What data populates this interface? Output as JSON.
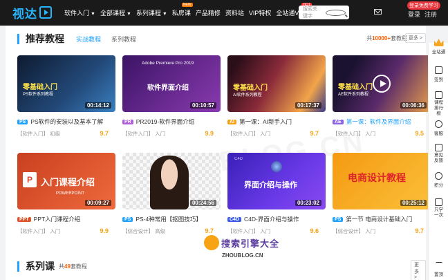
{
  "header": {
    "logo": "视达",
    "nav": [
      {
        "label": "软件入门",
        "caret": true
      },
      {
        "label": "全部课程",
        "caret": true
      },
      {
        "label": "系列课程",
        "caret": true
      },
      {
        "label": "私房课",
        "badge": "NEW"
      },
      {
        "label": "产品精修"
      },
      {
        "label": "资料站"
      },
      {
        "label": "VIP特权"
      },
      {
        "label": "全站通VIP",
        "badge": "HOT"
      }
    ],
    "search_placeholder": "搜索关键字",
    "promo": "登录免费学习",
    "login": "登录",
    "register": "注册"
  },
  "section": {
    "title": "推荐教程",
    "tab_active": "实战教程",
    "tab": "系列教程",
    "total_prefix": "共",
    "total_count": "10000+",
    "total_suffix": "套教程",
    "more": "更多 >"
  },
  "cards": [
    {
      "thumb_title": "零基础入门",
      "thumb_sub": "PS软件系列教程",
      "duration": "00:14:12",
      "tag": "PS",
      "title": "PS软件的安装以及基本了解",
      "category": "【软件入门】",
      "level": "初级",
      "score": "9.7",
      "bg": "#1d2a44",
      "tagColor": "#1fa3ff"
    },
    {
      "thumb_title": "软件界面介绍",
      "thumb_sub": "Adobe Premiere Pro 2019",
      "duration": "00:10:57",
      "tag": "PR",
      "title": "PR2019-软件界面介绍",
      "category": "【软件入门】",
      "level": "入门",
      "score": "9.9",
      "bg": "#5a2a8a",
      "tagColor": "#b05cdc"
    },
    {
      "thumb_title": "零基础入门",
      "thumb_sub": "AI软件系列教程",
      "duration": "00:17:37",
      "tag": "AI",
      "title": "第一课：AI新手入门",
      "category": "【软件入门】",
      "level": "入门",
      "score": "9.7",
      "bg": "#3a1a20",
      "tagColor": "#f7a313"
    },
    {
      "thumb_title": "零基础入门",
      "thumb_sub": "AE软件系列教程",
      "duration": "00:06:36",
      "tag": "AE",
      "title": "第一课：软件及界面介绍",
      "category": "【软件入门】",
      "level": "入门",
      "score": "9.5",
      "bg": "#2a2040",
      "tagColor": "#8a63e8"
    },
    {
      "thumb_title": "入门课程介绍",
      "thumb_sub": "POWERPOINT",
      "duration": "00:09:27",
      "tag": "PPT",
      "title": "PPT入门课程介绍",
      "category": "【软件入门】",
      "level": "入门",
      "score": "9.9",
      "bg": "#e0552d",
      "tagColor": "#e0552d"
    },
    {
      "thumb_title": "",
      "thumb_sub": "",
      "duration": "00:24:56",
      "tag": "PS",
      "title": "PS-4种常用【抠图技巧】",
      "category": "【综合设计】",
      "level": "高级",
      "score": "9.7",
      "bg": "#e8e8e8",
      "tagColor": "#1fa3ff"
    },
    {
      "thumb_title": "界面介绍与操作",
      "thumb_sub": "C4D",
      "duration": "00:23:02",
      "tag": "C4D",
      "title": "C4D-界面介绍与操作",
      "category": "【软件入门】",
      "level": "入门",
      "score": "9.6",
      "bg": "#4a2ad0",
      "tagColor": "#3b5de8"
    },
    {
      "thumb_title": "电商设计教程",
      "thumb_sub": "",
      "duration": "00:25:12",
      "tag": "PS",
      "title": "第一节 电商设计基础入门",
      "category": "【综合设计】",
      "level": "入门",
      "score": "9.7",
      "bg": "#f7a313",
      "tagColor": "#1fa3ff"
    }
  ],
  "series": {
    "title": "系列课",
    "count_prefix": "共",
    "count": "49",
    "count_suffix": "套教程",
    "more": "更多 >"
  },
  "sidebar": [
    {
      "label": "全站通",
      "icon": "crown-icon"
    },
    {
      "label": "签到",
      "icon": "calendar-icon"
    },
    {
      "label": "课程排行榜",
      "icon": "ranking-icon"
    },
    {
      "label": "客服",
      "icon": "headset-icon"
    },
    {
      "label": "意见反馈",
      "icon": "feedback-icon"
    },
    {
      "label": "积分",
      "icon": "coins-icon"
    },
    {
      "label": "只学一次",
      "icon": "tv-icon"
    },
    {
      "label": "置顶",
      "icon": "arrow-up-icon"
    }
  ],
  "watermark": {
    "main": "ZHOUBLOG.CN",
    "brand": "搜索引擎大全",
    "url": "ZHOUBLOG.CN"
  }
}
